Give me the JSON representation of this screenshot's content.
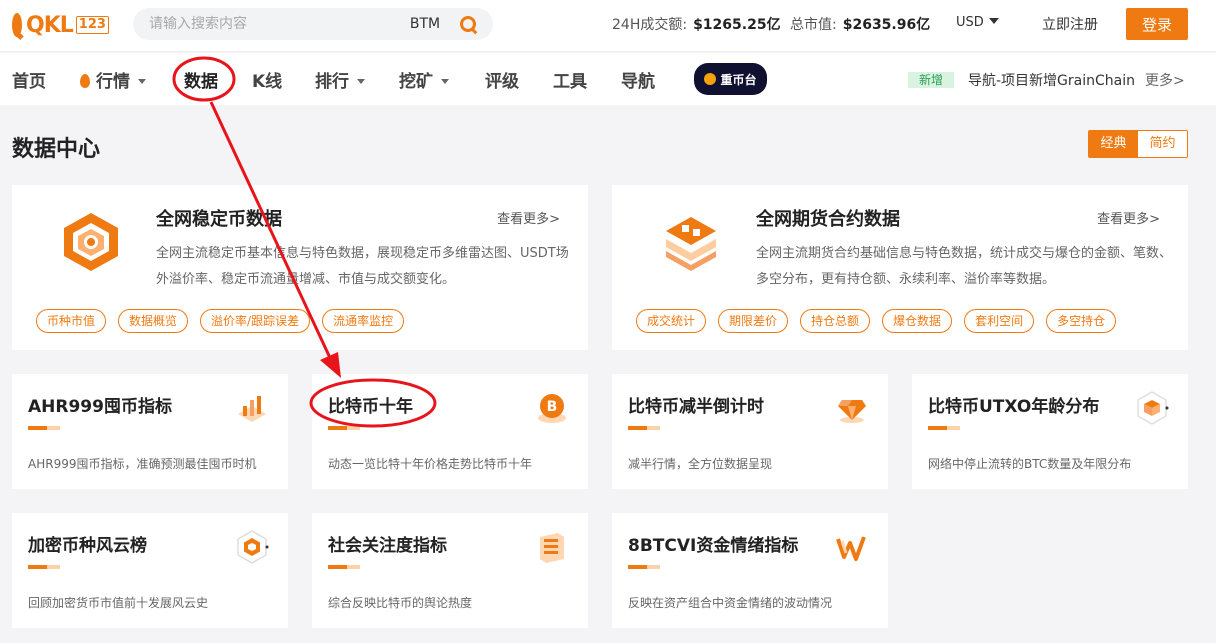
{
  "header": {
    "logo_text": "QKL",
    "logo_num": "123",
    "search_placeholder": "请输入搜索内容",
    "search_chip": "BTM",
    "volume_label": "24H成交额:",
    "volume_value": "$1265.25亿",
    "marketcap_label": "总市值:",
    "marketcap_value": "$2635.96亿",
    "currency": "USD",
    "register": "立即注册",
    "login": "登录"
  },
  "nav": {
    "items": [
      "首页",
      "行情",
      "数据",
      "K线",
      "排行",
      "挖矿",
      "评级",
      "工具",
      "导航"
    ],
    "promo": "重币台",
    "new_tag": "新增",
    "news": "导航-项目新增GrainChain",
    "more": "更多>"
  },
  "page": {
    "title": "数据中心",
    "view_classic": "经典",
    "view_simple": "简约"
  },
  "big_cards": [
    {
      "title": "全网稳定币数据",
      "more": "查看更多>",
      "desc": "全网主流稳定币基本信息与特色数据，展现稳定币多维雷达图、USDT场外溢价率、稳定币流通量增减、市值与成交额变化。",
      "tags": [
        "币种市值",
        "数据概览",
        "溢价率/跟踪误差",
        "流通率监控"
      ]
    },
    {
      "title": "全网期货合约数据",
      "more": "查看更多>",
      "desc": "全网主流期货合约基础信息与特色数据，统计成交与爆仓的金额、笔数、多空分布，更有持仓额、永续利率、溢价率等数据。",
      "tags": [
        "成交统计",
        "期限差价",
        "持仓总额",
        "爆仓数据",
        "套利空间",
        "多空持仓"
      ]
    }
  ],
  "cards": [
    {
      "title": "AHR999囤币指标",
      "desc": "AHR999囤币指标，准确预测最佳囤币时机",
      "icon": "bar-chart-icon"
    },
    {
      "title": "比特币十年",
      "desc": "动态一览比特十年价格走势比特币十年",
      "icon": "bitcoin-icon"
    },
    {
      "title": "比特币减半倒计时",
      "desc": "减半行情，全方位数据呈现",
      "icon": "diamond-icon"
    },
    {
      "title": "比特币UTXO年龄分布",
      "desc": "网络中停止流转的BTC数量及年限分布",
      "icon": "cube-icon"
    },
    {
      "title": "加密币种风云榜",
      "desc": "回顾加密货币市值前十发展风云史",
      "icon": "hexagon-icon"
    },
    {
      "title": "社会关注度指标",
      "desc": "综合反映比特币的舆论热度",
      "icon": "stack-icon"
    },
    {
      "title": "8BTCVI资金情绪指标",
      "desc": "反映在资产组合中资金情绪的波动情况",
      "icon": "wave-icon"
    }
  ],
  "colors": {
    "accent": "#f07a12",
    "annotation": "#e8141c"
  }
}
